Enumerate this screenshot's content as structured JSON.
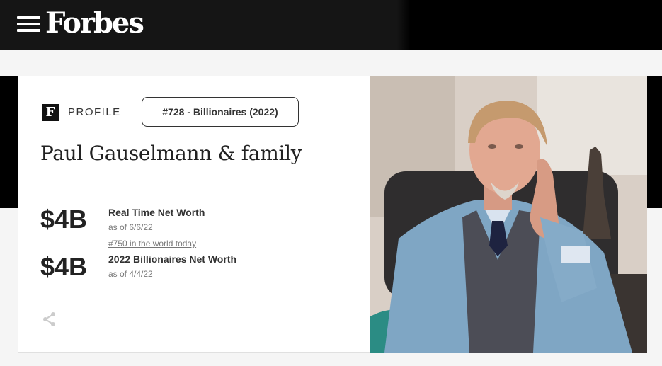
{
  "header": {
    "logo": "Forbes"
  },
  "profile": {
    "badge": "F",
    "label": "PROFILE",
    "rank_pill": "#728 - Billionaires (2022)",
    "name": "Paul Gauselmann & family",
    "realtime": {
      "amount": "$4B",
      "label": "Real Time Net Worth",
      "as_of": "as of 6/6/22",
      "world_rank": "#750 in the world today"
    },
    "annual": {
      "amount": "$4B",
      "label": "2022 Billionaires Net Worth",
      "as_of": "as of 4/4/22"
    }
  },
  "icons": {
    "menu": "hamburger-menu-icon",
    "share": "share-icon"
  },
  "colors": {
    "header_bg": "#151515",
    "text_dark": "#222222",
    "text_muted": "#777777"
  }
}
